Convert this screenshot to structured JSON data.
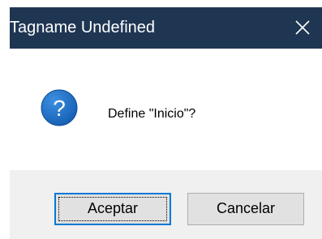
{
  "window": {
    "title": "Tagname Undefined",
    "close_icon": "close-icon"
  },
  "dialog": {
    "icon": "question-icon",
    "icon_color": "#1c6fc9",
    "message": "Define \"Inicio\"?"
  },
  "buttons": {
    "accept_label": "Aceptar",
    "cancel_label": "Cancelar",
    "default_button": "accept"
  },
  "colors": {
    "titlebar": "#1f3653",
    "footer": "#f0f0f0",
    "focus_accent": "#0078d7"
  }
}
